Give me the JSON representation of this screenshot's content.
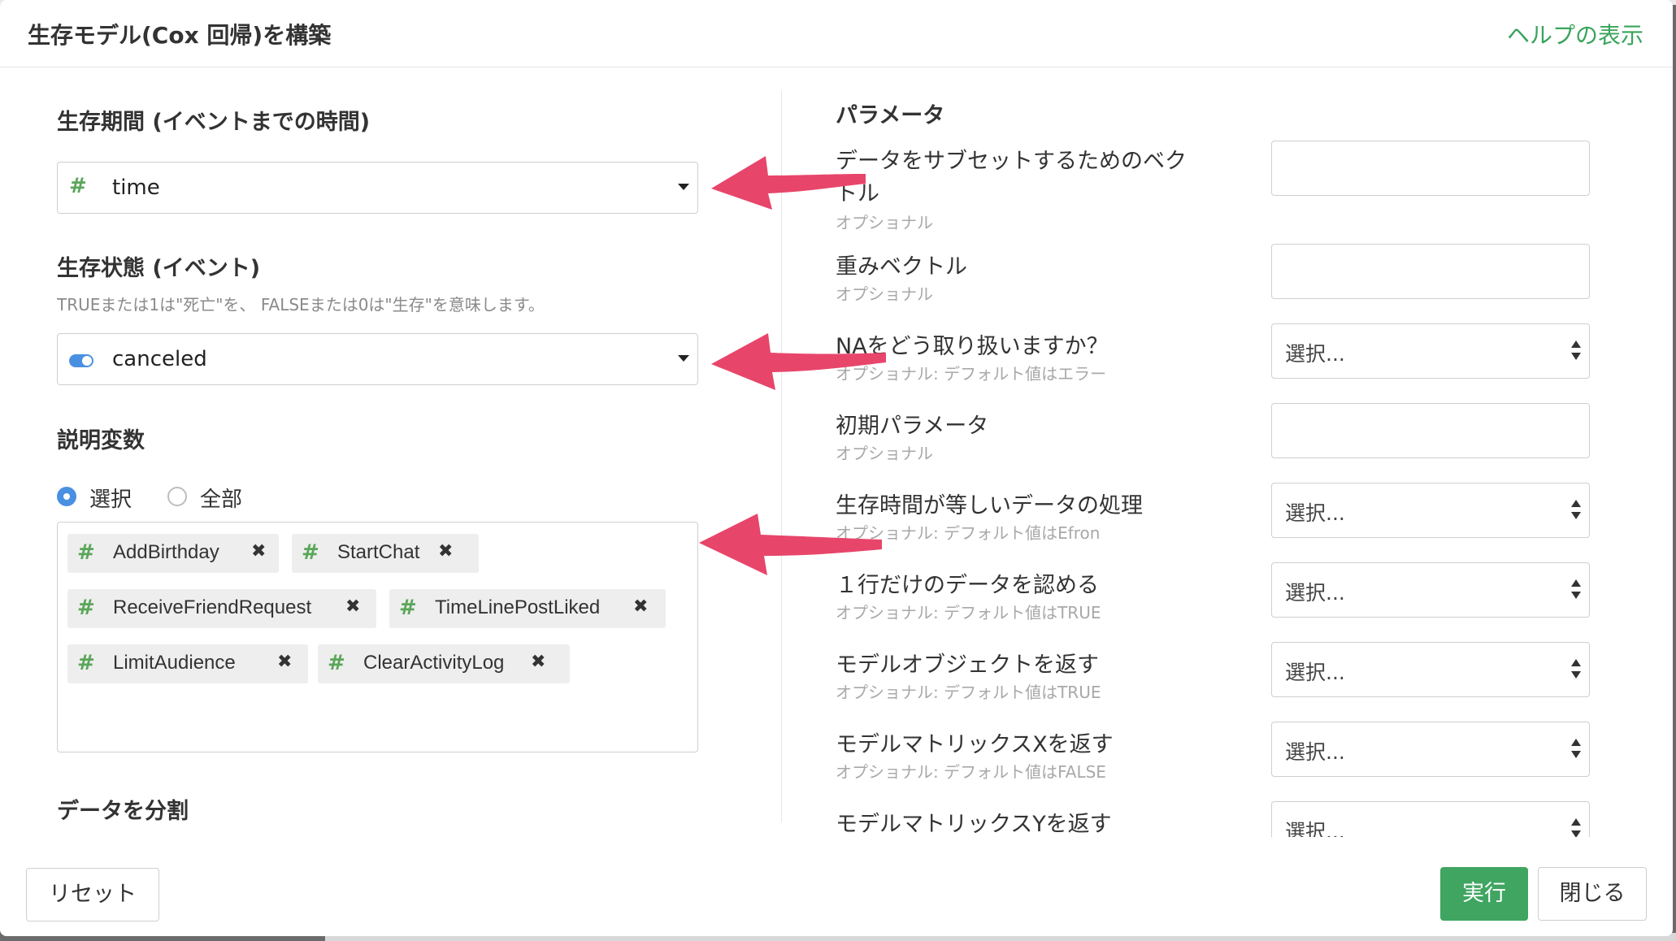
{
  "dialog": {
    "title": "生存モデル(Cox 回帰)を構築",
    "help_link": "ヘルプの表示"
  },
  "left": {
    "survival_time": {
      "label": "生存期間 (イベントまでの時間)",
      "type_icon": "number-hash-icon",
      "value": "time"
    },
    "survival_status": {
      "label": "生存状態 (イベント)",
      "hint": "TRUEまたは1は\"死亡\"を、 FALSEまたは0は\"生存\"を意味します。",
      "type_icon": "logical-toggle-icon",
      "value": "canceled"
    },
    "explanatory": {
      "label": "説明変数",
      "radio": [
        {
          "label": "選択",
          "selected": true
        },
        {
          "label": "全部",
          "selected": false
        }
      ],
      "tags": [
        {
          "label": "AddBirthday"
        },
        {
          "label": "StartChat"
        },
        {
          "label": "ReceiveFriendRequest"
        },
        {
          "label": "TimeLinePostLiked"
        },
        {
          "label": "LimitAudience"
        },
        {
          "label": "ClearActivityLog"
        }
      ],
      "tag_remove_glyph": "✖",
      "hash_glyph": "#"
    },
    "split": {
      "label": "データを分割"
    }
  },
  "params": {
    "title": "パラメータ",
    "items": [
      {
        "label_line1": "データをサブセットするためのベク",
        "label_line2": "トル",
        "sub": "オプショナル",
        "control": "input"
      },
      {
        "label": "重みベクトル",
        "sub": "オプショナル",
        "control": "input"
      },
      {
        "label": "NAをどう取り扱いますか？",
        "sub": "オプショナル: デフォルト値はエラー",
        "control": "select",
        "placeholder": "選択..."
      },
      {
        "label": "初期パラメータ",
        "sub": "オプショナル",
        "control": "input"
      },
      {
        "label": "生存時間が等しいデータの処理",
        "sub": "オプショナル: デフォルト値はEfron",
        "control": "select",
        "placeholder": "選択..."
      },
      {
        "label": "１行だけのデータを認める",
        "sub": "オプショナル: デフォルト値はTRUE",
        "control": "select",
        "placeholder": "選択..."
      },
      {
        "label": "モデルオブジェクトを返す",
        "sub": "オプショナル: デフォルト値はTRUE",
        "control": "select",
        "placeholder": "選択..."
      },
      {
        "label": "モデルマトリックスXを返す",
        "sub": "オプショナル: デフォルト値はFALSE",
        "control": "select",
        "placeholder": "選択..."
      },
      {
        "label": "モデルマトリックスYを返す",
        "control": "select",
        "placeholder": "選択..."
      }
    ]
  },
  "footer": {
    "reset": "リセット",
    "run": "実行",
    "close": "閉じる"
  },
  "colors": {
    "accent_green": "#3fa561",
    "help_link": "#3aa35c",
    "radio_blue": "#4a90e2",
    "annotation_arrow": "#e8456a",
    "number_icon": "#5aa65a"
  }
}
